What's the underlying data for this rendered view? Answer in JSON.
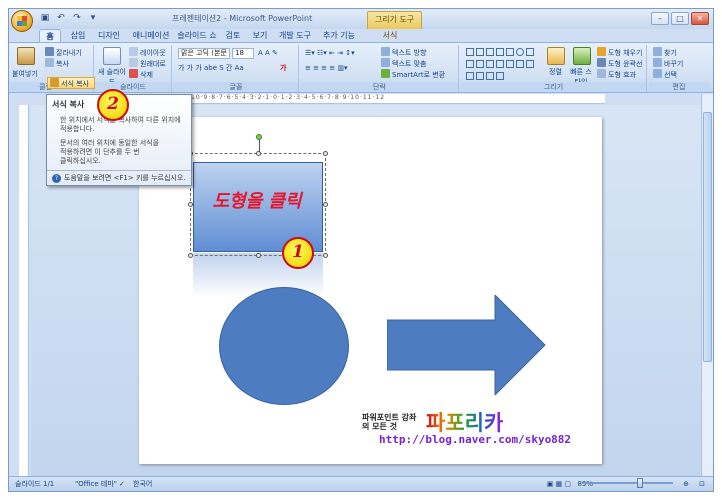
{
  "window": {
    "title": "프레젠테이션2 - Microsoft PowerPoint",
    "tools_tab": "그리기 도구",
    "qat_icons": [
      "save-icon",
      "undo-icon",
      "redo-icon",
      "customize-icon"
    ]
  },
  "tabs": [
    "홈",
    "삽입",
    "디자인",
    "애니메이션",
    "슬라이드 쇼",
    "검토",
    "보기",
    "개발 도구",
    "추가 기능",
    "서식"
  ],
  "ribbon": {
    "clipboard": {
      "label": "클립보드",
      "paste": "붙여넣기",
      "cut": "잘라내기",
      "copy": "복사",
      "format_painter": "서식 복사"
    },
    "slides": {
      "label": "슬라이드",
      "new_slide": "새 슬라이드",
      "layout": "레이아웃",
      "reset": "원래대로",
      "delete": "삭제"
    },
    "font": {
      "label": "글꼴",
      "font_name": "맑은 고딕 (본문",
      "font_size": "18",
      "row2": "가 가 가 abe S 간 Aa"
    },
    "paragraph": {
      "label": "단락",
      "text_direction": "텍스트 방향",
      "align_text": "텍스트 맞춤",
      "smartart": "SmartArt로 변환"
    },
    "drawing": {
      "label": "그리기",
      "arrange": "정렬",
      "quick_styles": "빠른 스타일",
      "shape_fill": "도형 채우기",
      "shape_outline": "도형 윤곽선",
      "shape_effects": "도형 효과"
    },
    "editing": {
      "label": "편집",
      "find": "찾기",
      "replace": "바꾸기",
      "select": "선택"
    }
  },
  "tooltip": {
    "title": "서식 복사",
    "line1": "한 위치에서 서식을 복사하여 다른 위치에",
    "line1b": "적용합니다.",
    "line2": "문서의 여러 위치에 동일한 서식을",
    "line2b": "적용하려면 이 단추를 두 번",
    "line2c": "클릭하십시오.",
    "help": "도움말을 보려면 <F1> 키를 누르십시오."
  },
  "ruler_text": "10·9·8·7·6·5·4·3·2·1·0·1·2·3·4·5·6·7·8·9·10·11·12",
  "slide": {
    "shape_text": "도형을 클릭",
    "marker1": "1",
    "marker2": "2",
    "watermark_small": "파워포인트 강좌의 모든 것",
    "watermark_big": "파포리카",
    "watermark_url": "http://blog.naver.com/skyo882"
  },
  "status": {
    "slide_info": "슬라이드 1/1",
    "theme": "\"Office 테마\"",
    "language": "한국어",
    "zoom": "89%"
  },
  "colors": {
    "marker_fill": "#f3e11a",
    "marker_border": "#d00a17",
    "shape_blue": "#4d7cc0"
  }
}
